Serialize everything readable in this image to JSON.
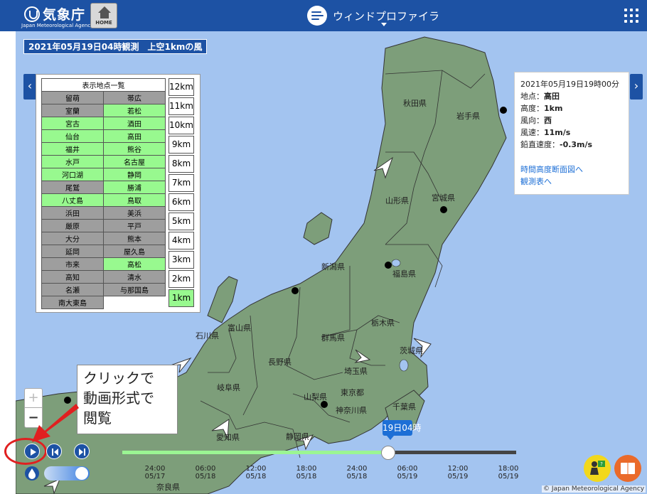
{
  "header": {
    "logo_text": "気象庁",
    "logo_sub": "Japan Meteorological Agency",
    "home_label": "HOME",
    "app_title": "ウィンドプロファイラ"
  },
  "obs_title": "2021年05月19日04時観測　上空1kmの風",
  "station_panel": {
    "header": "表示地点一覧",
    "rows": [
      [
        {
          "name": "留萌",
          "status": "gray"
        },
        {
          "name": "帯広",
          "status": "gray"
        }
      ],
      [
        {
          "name": "室蘭",
          "status": "gray"
        },
        {
          "name": "若松",
          "status": "green"
        }
      ],
      [
        {
          "name": "宮古",
          "status": "green"
        },
        {
          "name": "酒田",
          "status": "green"
        }
      ],
      [
        {
          "name": "仙台",
          "status": "green"
        },
        {
          "name": "高田",
          "status": "green"
        }
      ],
      [
        {
          "name": "福井",
          "status": "green"
        },
        {
          "name": "熊谷",
          "status": "green"
        }
      ],
      [
        {
          "name": "水戸",
          "status": "green"
        },
        {
          "name": "名古屋",
          "status": "green"
        }
      ],
      [
        {
          "name": "河口湖",
          "status": "green"
        },
        {
          "name": "静岡",
          "status": "green"
        }
      ],
      [
        {
          "name": "尾鷲",
          "status": "gray"
        },
        {
          "name": "勝浦",
          "status": "green"
        }
      ],
      [
        {
          "name": "八丈島",
          "status": "green"
        },
        {
          "name": "鳥取",
          "status": "green"
        }
      ],
      [
        {
          "name": "浜田",
          "status": "gray"
        },
        {
          "name": "美浜",
          "status": "gray"
        }
      ],
      [
        {
          "name": "厳原",
          "status": "gray"
        },
        {
          "name": "平戸",
          "status": "gray"
        }
      ],
      [
        {
          "name": "大分",
          "status": "gray"
        },
        {
          "name": "熊本",
          "status": "gray"
        }
      ],
      [
        {
          "name": "延岡",
          "status": "gray"
        },
        {
          "name": "屋久島",
          "status": "gray"
        }
      ],
      [
        {
          "name": "市来",
          "status": "gray"
        },
        {
          "name": "高松",
          "status": "green"
        }
      ],
      [
        {
          "name": "高知",
          "status": "gray"
        },
        {
          "name": "清水",
          "status": "gray"
        }
      ],
      [
        {
          "name": "名瀬",
          "status": "gray"
        },
        {
          "name": "与那国島",
          "status": "gray"
        }
      ],
      [
        {
          "name": "南大東島",
          "status": "gray"
        },
        {
          "name": "",
          "status": "white"
        }
      ]
    ],
    "altitudes": [
      "12km",
      "11km",
      "10km",
      "9km",
      "8km",
      "7km",
      "6km",
      "5km",
      "4km",
      "3km",
      "2km",
      "1km"
    ],
    "selected_altitude": "1km"
  },
  "info_panel": {
    "datetime": "2021年05月19日19時00分",
    "rows": [
      {
        "label": "地点：",
        "value": "高田"
      },
      {
        "label": "高度：",
        "value": "1km"
      },
      {
        "label": "風向：",
        "value": "西"
      },
      {
        "label": "風速：",
        "value": "11m/s"
      },
      {
        "label": "鉛直速度：",
        "value": "-0.3m/s"
      }
    ],
    "link1": "時間高度断面図へ",
    "link2": "観測表へ"
  },
  "map_labels": [
    {
      "text": "秋田県",
      "id": "akita"
    },
    {
      "text": "岩手県",
      "id": "iwate"
    },
    {
      "text": "山形県",
      "id": "yamagata"
    },
    {
      "text": "宮城県",
      "id": "miyagi"
    },
    {
      "text": "新潟県",
      "id": "niigata"
    },
    {
      "text": "福島県",
      "id": "fukushima"
    },
    {
      "text": "石川県",
      "id": "ishikawa"
    },
    {
      "text": "富山県",
      "id": "toyama"
    },
    {
      "text": "群馬県",
      "id": "gunma"
    },
    {
      "text": "栃木県",
      "id": "tochigi"
    },
    {
      "text": "茨城県",
      "id": "ibaraki"
    },
    {
      "text": "長野県",
      "id": "nagano"
    },
    {
      "text": "埼玉県",
      "id": "saitama"
    },
    {
      "text": "岐阜県",
      "id": "gifu"
    },
    {
      "text": "東京都",
      "id": "tokyo"
    },
    {
      "text": "山梨県",
      "id": "yamanashi"
    },
    {
      "text": "神奈川県",
      "id": "kanagawa"
    },
    {
      "text": "千葉県",
      "id": "chiba"
    },
    {
      "text": "愛知県",
      "id": "aichi"
    },
    {
      "text": "静岡県",
      "id": "shizuoka"
    },
    {
      "text": "奈良県",
      "id": "nara"
    }
  ],
  "callout": "クリックで\n動画形式で\n閲覧",
  "zoom": {
    "in": "+",
    "out": "−"
  },
  "timeline": {
    "current_label": "19日04時",
    "position_fraction": 0.675,
    "ticks": [
      {
        "time": "24:00",
        "date": "05/17"
      },
      {
        "time": "06:00",
        "date": "05/18"
      },
      {
        "time": "12:00",
        "date": "05/18"
      },
      {
        "time": "18:00",
        "date": "05/18"
      },
      {
        "time": "24:00",
        "date": "05/18"
      },
      {
        "time": "06:00",
        "date": "05/19"
      },
      {
        "time": "12:00",
        "date": "05/19"
      },
      {
        "time": "18:00",
        "date": "05/19"
      }
    ]
  },
  "toggle_on": true,
  "copyright": "© Japan Meteorological Agency",
  "colors": {
    "header": "#1d52a4",
    "sea": "#a3c4f0",
    "land": "#7d9e7a",
    "available": "#98f98f",
    "unavailable": "#9e9e9e",
    "callout_arrow": "#e02020"
  },
  "icons": [
    "home-icon",
    "wind-icon",
    "grid-menu-icon",
    "chevron-left-icon",
    "chevron-right-icon",
    "play-icon",
    "step-back-icon",
    "step-forward-icon",
    "drop-icon",
    "help-icon",
    "book-icon",
    "wind-arrow-icon",
    "station-dot"
  ]
}
